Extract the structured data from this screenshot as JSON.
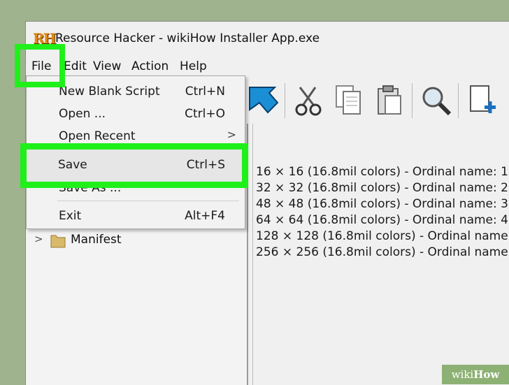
{
  "window": {
    "title": "Resource Hacker - wikiHow Installer App.exe",
    "logo_text": "RH"
  },
  "menubar": {
    "items": [
      "File",
      "Edit",
      "View",
      "Action",
      "Help"
    ]
  },
  "file_menu": {
    "items": [
      {
        "label": "New Blank Script",
        "shortcut": "Ctrl+N"
      },
      {
        "label": "Open ...",
        "shortcut": "Ctrl+O"
      },
      {
        "label": "Open Recent",
        "shortcut": "",
        "submenu_arrow": ">"
      },
      {
        "label": "Save",
        "shortcut": "Ctrl+S"
      },
      {
        "label": "Save As ...",
        "shortcut": ""
      },
      {
        "label": "Exit",
        "shortcut": "Alt+F4"
      }
    ]
  },
  "tree": {
    "items": [
      {
        "label": "Manifest",
        "expander": ">"
      }
    ]
  },
  "content": {
    "lines": [
      "16 × 16 (16.8mil colors) - Ordinal name: 1",
      "32 × 32 (16.8mil colors) - Ordinal name: 2",
      "48 × 48 (16.8mil colors) - Ordinal name: 3",
      "64 × 64 (16.8mil colors) - Ordinal name: 4",
      "128 × 128 (16.8mil colors) - Ordinal name:",
      "256 × 256 (16.8mil colors) - Ordinal name:"
    ]
  },
  "toolbar": {
    "icons": [
      "arrow-icon",
      "scissors-icon",
      "copy-icon",
      "paste-icon",
      "search-icon",
      "new-file-icon"
    ]
  },
  "highlight_color": "#1ff01a",
  "watermark": {
    "prefix": "wiki",
    "suffix": "How"
  }
}
